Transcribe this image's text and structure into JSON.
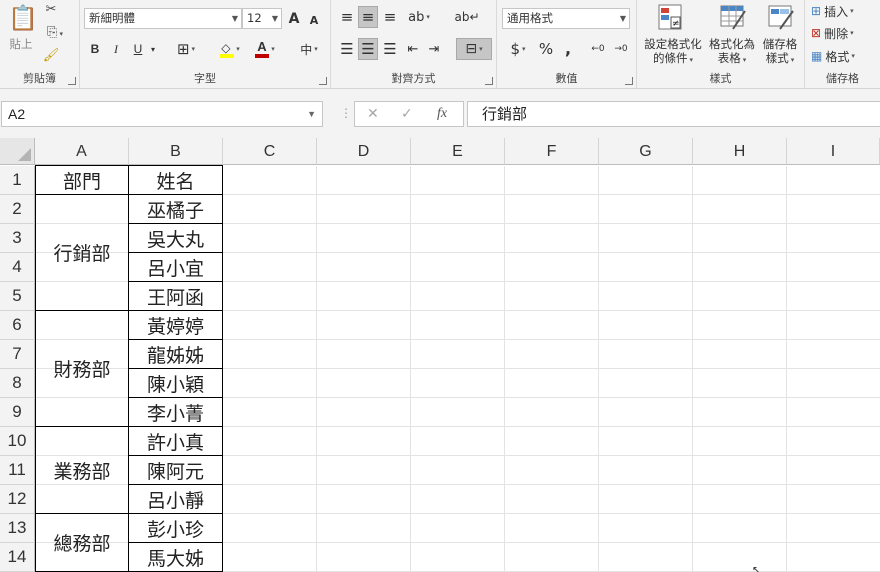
{
  "ribbon": {
    "clipboard": {
      "paste_label": "貼上",
      "group_label": "剪貼簿"
    },
    "font": {
      "font_name": "新細明體",
      "font_size": "12",
      "grow_label": "A",
      "shrink_label": "A",
      "bold": "B",
      "italic": "I",
      "underline": "U",
      "phonetic": "中",
      "group_label": "字型",
      "highlight_color": "#ffff00",
      "font_color": "#c00000"
    },
    "alignment": {
      "group_label": "對齊方式"
    },
    "number": {
      "format": "通用格式",
      "currency": "$",
      "percent": "%",
      "comma": ",",
      "increase_decimal": "←0",
      "decrease_decimal": "→0",
      "group_label": "數值"
    },
    "styles": {
      "conditional_label_1": "設定格式化",
      "conditional_label_2": "的條件",
      "table_label_1": "格式化為",
      "table_label_2": "表格",
      "cell_label_1": "儲存格",
      "cell_label_2": "樣式",
      "group_label": "樣式"
    },
    "cells": {
      "insert": "插入",
      "delete": "刪除",
      "format": "格式",
      "group_label": "儲存格"
    }
  },
  "formula_bar": {
    "name_box": "A2",
    "cancel_icon": "✕",
    "enter_icon": "✓",
    "fx_label": "fx",
    "formula": "行銷部"
  },
  "sheet": {
    "columns": [
      "A",
      "B",
      "C",
      "D",
      "E",
      "F",
      "G",
      "H",
      "I"
    ],
    "rows": [
      "1",
      "2",
      "3",
      "4",
      "5",
      "6",
      "7",
      "8",
      "9",
      "10",
      "11",
      "12",
      "13",
      "14"
    ],
    "headers": {
      "dept": "部門",
      "name": "姓名"
    },
    "departments": [
      "行銷部",
      "財務部",
      "業務部",
      "總務部"
    ],
    "names": [
      "巫橘子",
      "吳大丸",
      "呂小宜",
      "王阿函",
      "黃婷婷",
      "龍姊姊",
      "陳小穎",
      "李小菁",
      "許小真",
      "陳阿元",
      "呂小靜",
      "彭小珍",
      "馬大姊"
    ]
  }
}
